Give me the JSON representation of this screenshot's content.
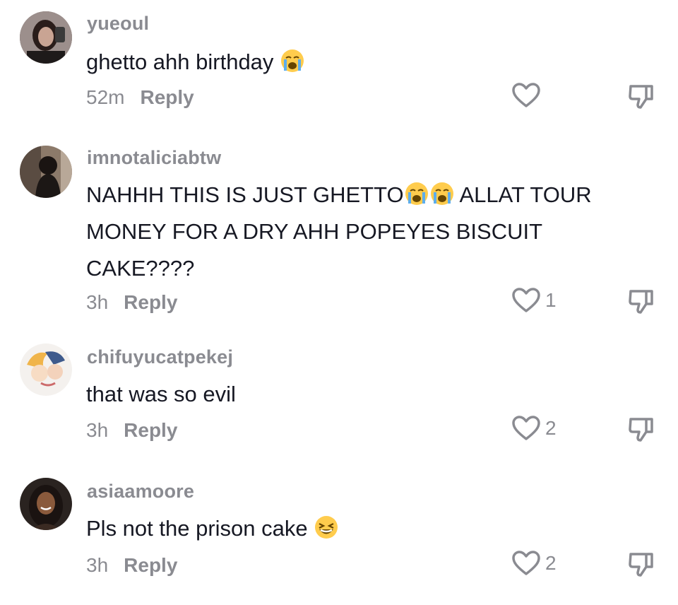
{
  "comments": [
    {
      "username": "yueoul",
      "text": "ghetto ahh birthday",
      "emoji_after": "crying-emoji",
      "time": "52m",
      "reply_label": "Reply",
      "likes": ""
    },
    {
      "username": "imnotaliciabtw",
      "text_part1": "NAHHH THIS IS JUST GHETTO",
      "text_part2": " ALLAT TOUR MONEY FOR A DRY AHH POPEYES BISCUIT CAKE????",
      "time": "3h",
      "reply_label": "Reply",
      "likes": "1"
    },
    {
      "username": "chifuyucatpekej",
      "text": "that was so evil",
      "time": "3h",
      "reply_label": "Reply",
      "likes": "2"
    },
    {
      "username": "asiaamoore",
      "text": "Pls not the prison cake",
      "emoji_after": "laughing-emoji",
      "time": "3h",
      "reply_label": "Reply",
      "likes": "2"
    }
  ],
  "icons": {
    "like": "heart-outline-icon",
    "dislike": "thumbs-down-outline-icon"
  },
  "colors": {
    "text": "#161823",
    "secondary": "#8a8b91",
    "background": "#ffffff"
  }
}
